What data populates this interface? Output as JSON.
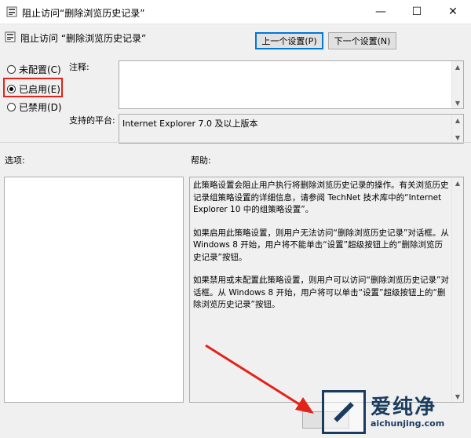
{
  "window": {
    "title": "阻止访问“删除浏览历史记录”",
    "minimize": "—",
    "maximize": "☐",
    "close": "✕"
  },
  "header": {
    "title": "阻止访问 “删除浏览历史记录”",
    "prev_button": "上一个设置(P)",
    "next_button": "下一个设置(N)"
  },
  "state": {
    "options": [
      {
        "label": "未配置(C)",
        "selected": false
      },
      {
        "label": "已启用(E)",
        "selected": true
      },
      {
        "label": "已禁用(D)",
        "selected": false
      }
    ]
  },
  "comment": {
    "label": "注释:",
    "value": ""
  },
  "platform": {
    "label": "支持的平台:",
    "value": "Internet Explorer 7.0 及以上版本"
  },
  "options_section": {
    "label": "选项:"
  },
  "help_section": {
    "label": "帮助:",
    "paragraphs": [
      "此策略设置会阻止用户执行将删除浏览历史记录的操作。有关浏览历史记录组策略设置的详细信息，请参阅 TechNet 技术库中的“Internet Explorer 10 中的组策略设置”。",
      "如果启用此策略设置，则用户无法访问“删除浏览历史记录”对话框。从 Windows 8 开始，用户将不能单击“设置”超级按钮上的“删除浏览历史记录”按钮。",
      "如果禁用或未配置此策略设置，则用户可以访问“删除浏览历史记录”对话框。从 Windows 8 开始，用户将可以单击“设置”超级按钮上的“删除浏览历史记录”按钮。"
    ]
  },
  "watermark": {
    "name": "爱纯净",
    "url": "aichunjing.com"
  },
  "colors": {
    "highlight": "#e2231a",
    "arrow": "#e2231a",
    "accent": "#0078d7"
  }
}
